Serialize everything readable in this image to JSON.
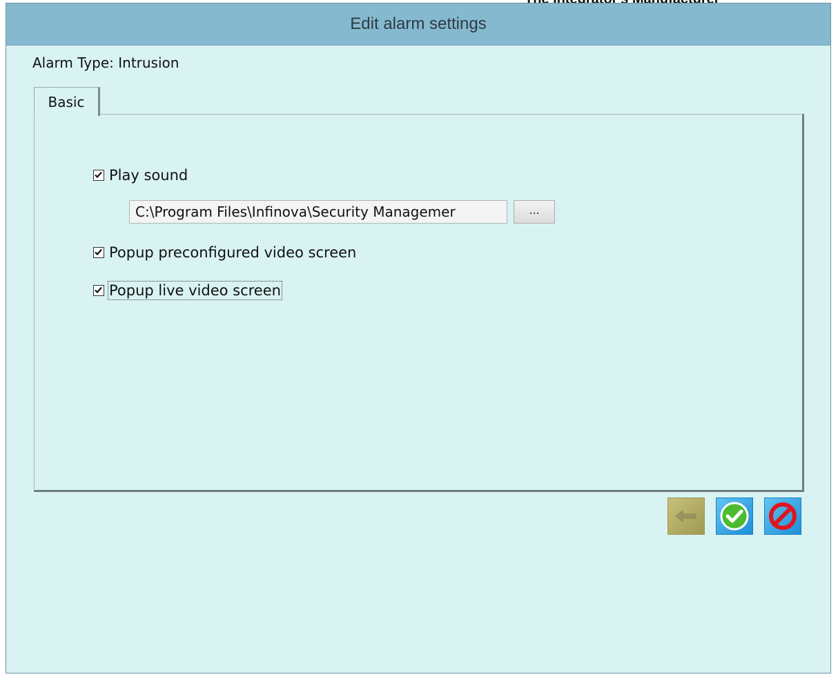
{
  "background_text": "The Integrator's Manufacturer",
  "window": {
    "title": "Edit alarm settings",
    "alarm_type_label": "Alarm Type: Intrusion"
  },
  "tabs": [
    {
      "label": "Basic",
      "active": true
    }
  ],
  "basic": {
    "play_sound": {
      "label": "Play sound",
      "checked": true
    },
    "sound_path": {
      "value": "C:\\Program Files\\Infinova\\Security Managemer"
    },
    "browse_label": "...",
    "popup_preconfigured": {
      "label": "Popup preconfigured video screen",
      "checked": true
    },
    "popup_live": {
      "label": "Popup live video screen",
      "checked": true
    }
  },
  "actions": {
    "back_icon": "back-arrow-icon",
    "ok_icon": "green-check-icon",
    "cancel_icon": "red-prohibition-icon"
  },
  "colors": {
    "titlebar": "#85b9cf",
    "window_bg": "#d9f3f3",
    "accent_blue": "#1e8fd8",
    "ok_green": "#4cbb2f",
    "cancel_red": "#e0141e"
  }
}
